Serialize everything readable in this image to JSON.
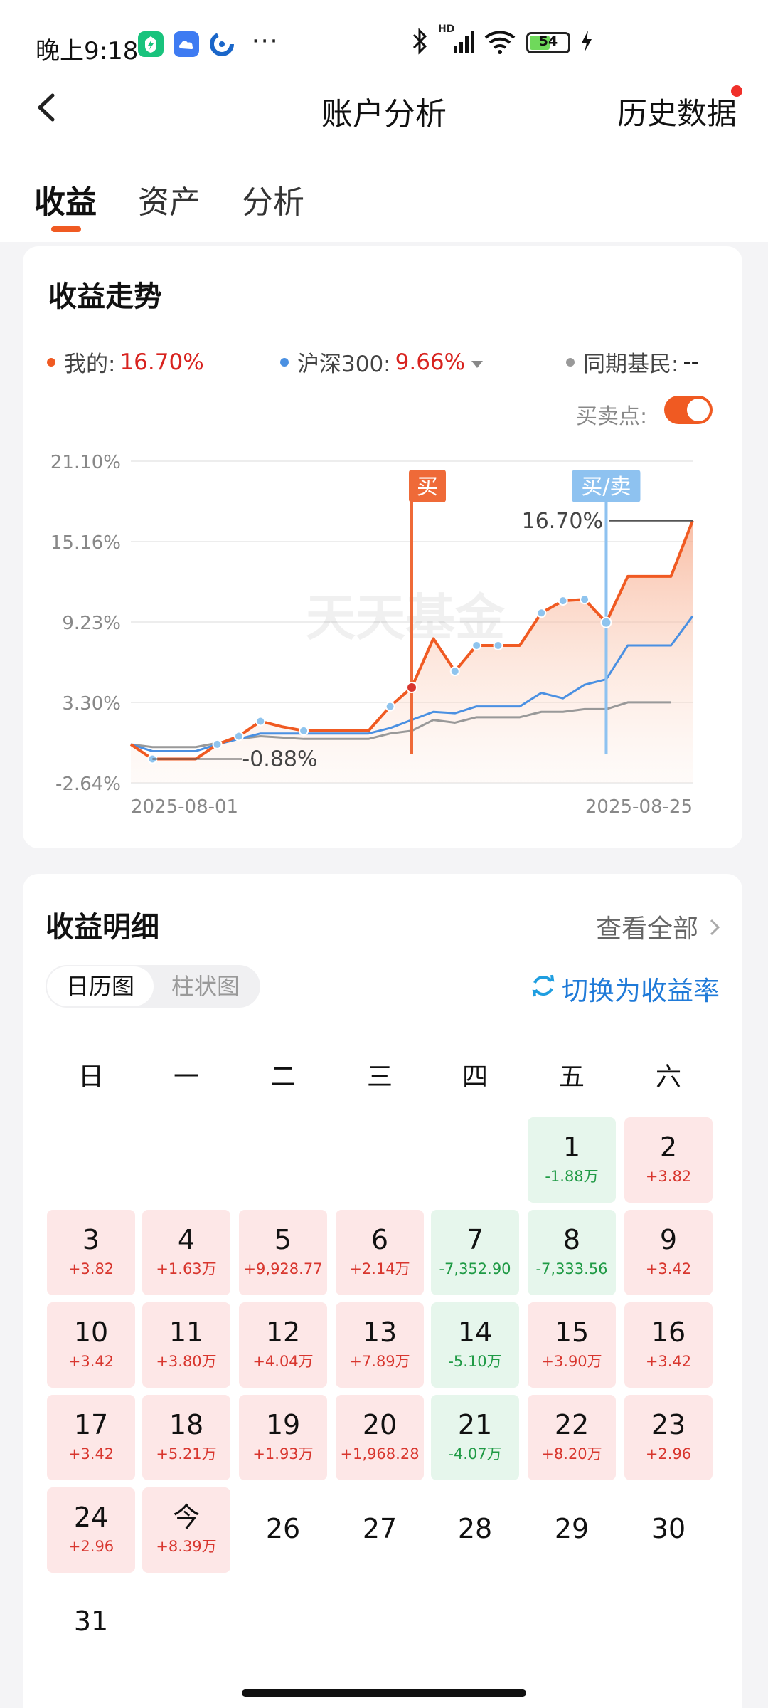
{
  "status_bar": {
    "time": "晚上9:18",
    "dots": "···",
    "network": "HD",
    "battery": "54",
    "apps": [
      {
        "name": "app-green-icon",
        "color": "#19c37d"
      },
      {
        "name": "weather-cloud-icon",
        "color": "#3e7bf2"
      },
      {
        "name": "app-blue-icon",
        "color": "#1a66c9"
      }
    ]
  },
  "header": {
    "title": "账户分析",
    "history": "历史数据"
  },
  "tabs": [
    {
      "label": "收益",
      "active": true
    },
    {
      "label": "资产",
      "active": false
    },
    {
      "label": "分析",
      "active": false
    }
  ],
  "trend": {
    "title": "收益走势",
    "legend": [
      {
        "label": "我的:",
        "value": "16.70%",
        "color": "#f05a22",
        "value_color": "#d8231f"
      },
      {
        "label": "沪深300:",
        "value": "9.66%",
        "color": "#4a90e2",
        "value_color": "#d8231f"
      },
      {
        "label": "同期基民:",
        "value": "--",
        "color": "#999999",
        "value_color": "#222222"
      }
    ],
    "buy_sell_label": "买卖点:",
    "buy_sell_enabled": true
  },
  "chart_data": {
    "type": "line",
    "watermark": "天天基金",
    "yticks": [
      "21.10%",
      "15.16%",
      "9.23%",
      "3.30%",
      "-2.64%"
    ],
    "ylim": [
      -2.64,
      21.1
    ],
    "xlabels": [
      "2025-08-01",
      "2025-08-25"
    ],
    "x": [
      "08-01",
      "08-02",
      "08-03",
      "08-04",
      "08-05",
      "08-06",
      "08-07",
      "08-08",
      "08-09",
      "08-10",
      "08-11",
      "08-12",
      "08-13",
      "08-14",
      "08-15",
      "08-16",
      "08-17",
      "08-18",
      "08-19",
      "08-20",
      "08-21",
      "08-22",
      "08-23",
      "08-24",
      "08-25"
    ],
    "series": [
      {
        "name": "我的",
        "color": "#f05a22",
        "values": [
          0.2,
          -0.88,
          -0.88,
          -0.88,
          0.2,
          0.8,
          1.9,
          1.5,
          1.2,
          1.2,
          1.2,
          1.2,
          3.0,
          4.4,
          8.0,
          5.6,
          7.5,
          7.5,
          7.5,
          9.9,
          10.8,
          10.9,
          9.2,
          12.6,
          12.6,
          12.6,
          16.7
        ]
      },
      {
        "name": "沪深300",
        "color": "#4a90e2",
        "values": [
          0.2,
          -0.3,
          -0.3,
          -0.3,
          0.2,
          0.6,
          1.0,
          1.0,
          1.0,
          1.0,
          1.0,
          1.0,
          1.4,
          2.0,
          2.6,
          2.5,
          3.0,
          3.0,
          3.0,
          4.0,
          3.6,
          4.6,
          5.0,
          7.5,
          7.5,
          7.5,
          9.66
        ]
      },
      {
        "name": "同期基民",
        "color": "#999999",
        "values": [
          0.2,
          0.0,
          0.0,
          0.0,
          0.3,
          0.6,
          0.8,
          0.7,
          0.6,
          0.6,
          0.6,
          0.6,
          1.0,
          1.2,
          2.0,
          1.8,
          2.2,
          2.2,
          2.2,
          2.6,
          2.6,
          2.8,
          2.8,
          3.3,
          3.3,
          3.3
        ]
      }
    ],
    "markers": [
      {
        "label": "买",
        "color": "#ef6a38",
        "index": 13
      },
      {
        "label": "买/卖",
        "color": "#8ec2f0",
        "index": 22
      }
    ],
    "annotations": {
      "min_label": "-0.88%",
      "max_label": "16.70%"
    }
  },
  "details": {
    "title": "收益明细",
    "see_all": "查看全部",
    "segments": [
      "日历图",
      "柱状图"
    ],
    "switch": "切换为收益率",
    "weekdays": [
      "日",
      "一",
      "二",
      "三",
      "四",
      "五",
      "六"
    ],
    "days": [
      {
        "day": "1",
        "amount": "-1.88万",
        "type": "neg",
        "col": 5,
        "row": 0
      },
      {
        "day": "2",
        "amount": "+3.82",
        "type": "pos",
        "col": 6,
        "row": 0
      },
      {
        "day": "3",
        "amount": "+3.82",
        "type": "pos",
        "col": 0,
        "row": 1
      },
      {
        "day": "4",
        "amount": "+1.63万",
        "type": "pos",
        "col": 1,
        "row": 1
      },
      {
        "day": "5",
        "amount": "+9,928.77",
        "type": "pos",
        "col": 2,
        "row": 1
      },
      {
        "day": "6",
        "amount": "+2.14万",
        "type": "pos",
        "col": 3,
        "row": 1
      },
      {
        "day": "7",
        "amount": "-7,352.90",
        "type": "neg",
        "col": 4,
        "row": 1
      },
      {
        "day": "8",
        "amount": "-7,333.56",
        "type": "neg",
        "col": 5,
        "row": 1
      },
      {
        "day": "9",
        "amount": "+3.42",
        "type": "pos",
        "col": 6,
        "row": 1
      },
      {
        "day": "10",
        "amount": "+3.42",
        "type": "pos",
        "col": 0,
        "row": 2
      },
      {
        "day": "11",
        "amount": "+3.80万",
        "type": "pos",
        "col": 1,
        "row": 2
      },
      {
        "day": "12",
        "amount": "+4.04万",
        "type": "pos",
        "col": 2,
        "row": 2
      },
      {
        "day": "13",
        "amount": "+7.89万",
        "type": "pos",
        "col": 3,
        "row": 2
      },
      {
        "day": "14",
        "amount": "-5.10万",
        "type": "neg",
        "col": 4,
        "row": 2
      },
      {
        "day": "15",
        "amount": "+3.90万",
        "type": "pos",
        "col": 5,
        "row": 2
      },
      {
        "day": "16",
        "amount": "+3.42",
        "type": "pos",
        "col": 6,
        "row": 2
      },
      {
        "day": "17",
        "amount": "+3.42",
        "type": "pos",
        "col": 0,
        "row": 3
      },
      {
        "day": "18",
        "amount": "+5.21万",
        "type": "pos",
        "col": 1,
        "row": 3
      },
      {
        "day": "19",
        "amount": "+1.93万",
        "type": "pos",
        "col": 2,
        "row": 3
      },
      {
        "day": "20",
        "amount": "+1,968.28",
        "type": "pos",
        "col": 3,
        "row": 3
      },
      {
        "day": "21",
        "amount": "-4.07万",
        "type": "neg",
        "col": 4,
        "row": 3
      },
      {
        "day": "22",
        "amount": "+8.20万",
        "type": "pos",
        "col": 5,
        "row": 3
      },
      {
        "day": "23",
        "amount": "+2.96",
        "type": "pos",
        "col": 6,
        "row": 3
      },
      {
        "day": "24",
        "amount": "+2.96",
        "type": "pos",
        "col": 0,
        "row": 4
      },
      {
        "day": "今",
        "amount": "+8.39万",
        "type": "pos",
        "col": 1,
        "row": 4
      },
      {
        "day": "26",
        "amount": "",
        "type": "plain",
        "col": 2,
        "row": 4
      },
      {
        "day": "27",
        "amount": "",
        "type": "plain",
        "col": 3,
        "row": 4
      },
      {
        "day": "28",
        "amount": "",
        "type": "plain",
        "col": 4,
        "row": 4
      },
      {
        "day": "29",
        "amount": "",
        "type": "plain",
        "col": 5,
        "row": 4
      },
      {
        "day": "30",
        "amount": "",
        "type": "plain",
        "col": 6,
        "row": 4
      },
      {
        "day": "31",
        "amount": "",
        "type": "plain",
        "col": 0,
        "row": 5
      }
    ]
  }
}
